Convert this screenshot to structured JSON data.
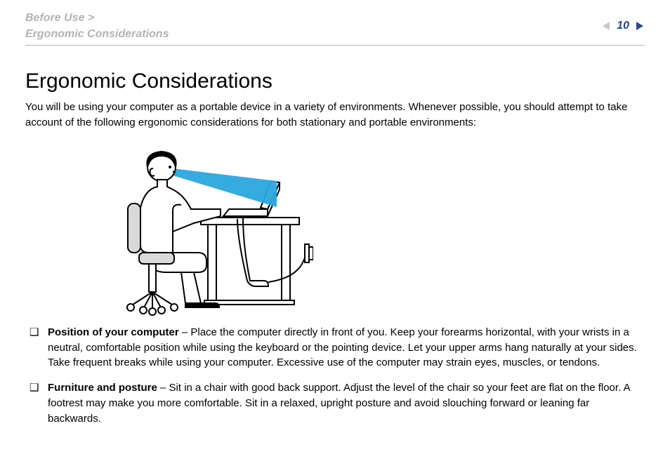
{
  "header": {
    "breadcrumb_line1": "Before Use",
    "breadcrumb_sep": ">",
    "breadcrumb_line2": "Ergonomic Considerations",
    "page_number": "10"
  },
  "body": {
    "title": "Ergonomic Considerations",
    "intro": "You will be using your computer as a portable device in a variety of environments. Whenever possible, you should attempt to take account of the following ergonomic considerations for both stationary and portable environments:",
    "bullets": [
      {
        "lead": "Position of your computer",
        "rest": " – Place the computer directly in front of you. Keep your forearms horizontal, with your wrists in a neutral, comfortable position while using the keyboard or the pointing device. Let your upper arms hang naturally at your sides. Take frequent breaks while using your computer. Excessive use of the computer may strain eyes, muscles, or tendons."
      },
      {
        "lead": "Furniture and posture",
        "rest": " – Sit in a chair with good back support. Adjust the level of the chair so your feet are flat on the floor. A footrest may make you more comfortable. Sit in a relaxed, upright posture and avoid slouching forward or leaning far backwards."
      }
    ],
    "bullet_marker": "❑"
  }
}
